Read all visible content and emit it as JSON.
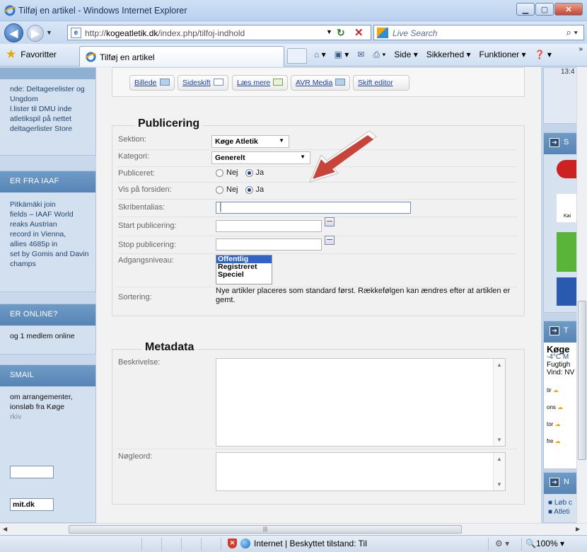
{
  "window": {
    "title": "Tilføj en artikel - Windows Internet Explorer",
    "address_prefix": "http://",
    "address_host": "kogeatletik.dk",
    "address_path": "/index.php/tilfoj-indhold",
    "search_placeholder": "Live Search"
  },
  "commandbar": {
    "favorites": "Favoritter",
    "tab_title": "Tilføj en artikel",
    "side": "Side",
    "sikkerhed": "Sikkerhed",
    "funktioner": "Funktioner"
  },
  "editor_buttons": [
    "Billede",
    "Sideskift",
    "Læs mere",
    "AVR Media",
    "Skift editor"
  ],
  "publicering": {
    "legend": "Publicering",
    "sektion_label": "Sektion:",
    "sektion_value": "Køge Atletik",
    "kategori_label": "Kategori:",
    "kategori_value": "Generelt",
    "publiceret_label": "Publiceret:",
    "forsiden_label": "Vis på forsiden:",
    "no": "Nej",
    "yes": "Ja",
    "alias_label": "Skribentalias:",
    "start_label": "Start publicering:",
    "stop_label": "Stop publicering:",
    "adgang_label": "Adgangsniveau:",
    "adgang_options": [
      "Offentlig",
      "Registreret",
      "Speciel"
    ],
    "sortering_label": "Sortering:",
    "sortering_note": "Nye artikler placeres som standard først. Rækkefølgen kan ændres efter at artiklen er gemt."
  },
  "metadata": {
    "legend": "Metadata",
    "beskrivelse_label": "Beskrivelse:",
    "noegleord_label": "Nøgleord:"
  },
  "left_sidebar": {
    "lines_top": [
      "nde: Deltagerelister og",
      "",
      "Ungdom",
      "l.lister til DMU inde",
      "atletikspil på nettet",
      "deltagerlister Store"
    ],
    "iaaf_title": "ER FRA IAAF",
    "iaaf_lines": [
      "Pitkämäki join",
      "fields – IAAF World",
      "",
      "reaks Austrian",
      "record in Vienna,",
      "allies 4685p in",
      "",
      "set by Gomis and Davin",
      "champs"
    ],
    "online_title": "ER ONLINE?",
    "online_text": "og 1 medlem online",
    "smail_title": "SMAIL",
    "smail_lines": [
      "om arrangementer,",
      "ionsløb fra Køge",
      "",
      "",
      "rkiv"
    ],
    "input_value": "",
    "mail_value": "mit.dk"
  },
  "right_sidebar": {
    "time": "13:4",
    "panel1_letter": "S",
    "panel2_letter": "T",
    "panel3_letter": "N",
    "weather_city": "Køge",
    "weather_temp": "-4°C M",
    "weather_hum": "Fugtigh",
    "weather_wind": "Vind: NV",
    "days": [
      "tir",
      "ons",
      "tor",
      "fre"
    ],
    "links": [
      "Løb c",
      "Atleti"
    ],
    "kai": "Kai"
  },
  "status": {
    "zone": "Internet | Beskyttet tilstand: Til",
    "zoom": "100%"
  },
  "colors": {
    "panel_header": "#5f8cbc",
    "accent_blue": "#2f63c8",
    "arrow_red": "#c8433a"
  }
}
